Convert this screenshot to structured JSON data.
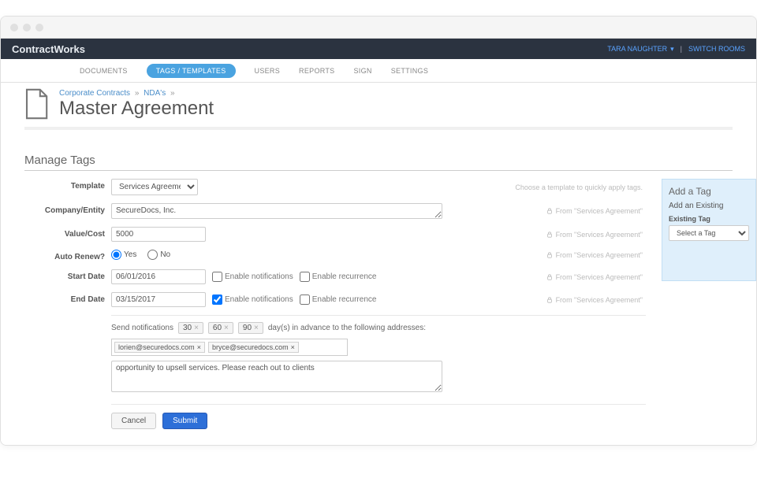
{
  "brand": "ContractWorks",
  "user_name": "TARA NAUGHTER",
  "switch_rooms": "SWITCH ROOMS",
  "nav": {
    "documents": "DOCUMENTS",
    "tags": "TAGS / TEMPLATES",
    "users": "USERS",
    "reports": "REPORTS",
    "sign": "SIGN",
    "settings": "SETTINGS"
  },
  "breadcrumb": {
    "a": "Corporate Contracts",
    "b": "NDA's",
    "sep": "»"
  },
  "page_title": "Master Agreement",
  "section_title": "Manage Tags",
  "labels": {
    "template": "Template",
    "company": "Company/Entity",
    "value": "Value/Cost",
    "autorenew": "Auto Renew?",
    "start": "Start Date",
    "end": "End Date"
  },
  "template_hint": "Choose a template to quickly apply tags.",
  "template_value": "Services Agreement",
  "company_value": "SecureDocs, Inc.",
  "value_value": "5000",
  "radio": {
    "yes": "Yes",
    "no": "No"
  },
  "start_value": "06/01/2016",
  "end_value": "03/15/2017",
  "enable_notif": "Enable notifications",
  "enable_recur": "Enable recurrence",
  "origin_text": "From \"Services Agreement\"",
  "notif": {
    "pre": "Send notifications",
    "days": [
      "30",
      "60",
      "90"
    ],
    "post": "day(s) in advance to the following addresses:",
    "emails": [
      "lorien@securedocs.com",
      "bryce@securedocs.com"
    ],
    "message": "opportunity to upsell services. Please reach out to clients"
  },
  "buttons": {
    "cancel": "Cancel",
    "submit": "Submit"
  },
  "side": {
    "title": "Add a Tag",
    "sub": "Add an Existing",
    "existing": "Existing Tag",
    "select": "Select a Tag"
  }
}
